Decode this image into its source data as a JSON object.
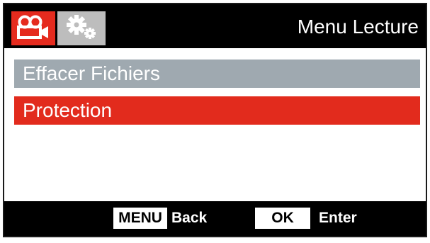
{
  "header": {
    "title": "Menu Lecture",
    "tabs": [
      {
        "icon": "video-camera-icon",
        "active": true,
        "color": "#e52b1e"
      },
      {
        "icon": "settings-gears-icon",
        "active": false,
        "color": "#bdbdbd"
      }
    ]
  },
  "menu": {
    "items": [
      {
        "label": "Effacer Fichiers",
        "selected": false,
        "color": "#9fa9b0"
      },
      {
        "label": "Protection",
        "selected": true,
        "color": "#e22b1d"
      }
    ]
  },
  "footer": {
    "menu_key": "MENU",
    "menu_action": "Back",
    "ok_key": "OK",
    "ok_action": "Enter"
  }
}
